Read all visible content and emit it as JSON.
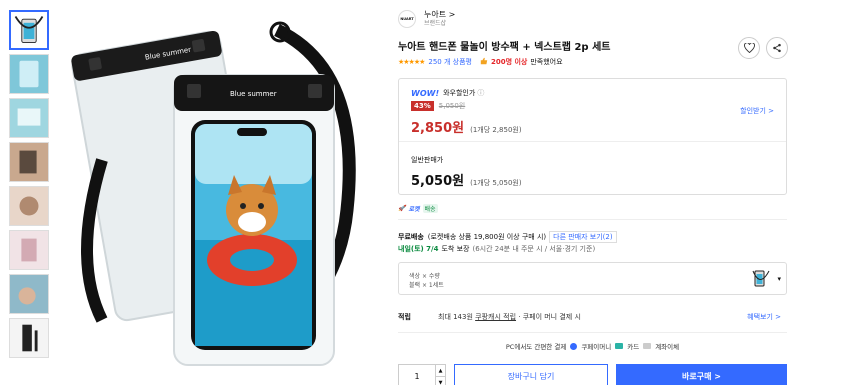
{
  "brand": {
    "logo_text": "NUART",
    "name": "누아트",
    "chevron": ">",
    "subtitle": "브랜드샵"
  },
  "product": {
    "title": "누아트 핸드폰 물놀이 방수팩 + 넥스트랩 2p 세트",
    "pouch_label": "Blue summer"
  },
  "rating": {
    "stars": "★★★★★",
    "review_count": "250 개 상품평",
    "satisfied_count": "200명 이상",
    "satisfied_text": "만족했어요"
  },
  "wow": {
    "logo": "WOW!",
    "label": "와우할인가",
    "info": "ⓘ",
    "discount": "43%",
    "original_price": "5,050원",
    "price": "2,850원",
    "unit_price": "(1개당 2,850원)",
    "coupon": "할인받기 >"
  },
  "normal": {
    "label": "일반판매가",
    "price": "5,050원",
    "unit_price": "(1개당 5,050원)"
  },
  "rocket": {
    "badge": "로켓",
    "tag": "배송"
  },
  "shipping": {
    "free_label": "무료배송",
    "free_text": "(로켓배송 상품 19,800원 이상 구매 시)",
    "other_seller": "다른 판매자 보기(2)",
    "arrive": "내일(토) 7/4",
    "arrive_suffix": "도착 보장",
    "note": "(6시간 24분 내 주문 시 / 서울·경기 기준)"
  },
  "option": {
    "line1": "색상 × 수량",
    "line2": "블랙 × 1세트",
    "caret": "▾"
  },
  "points": {
    "label": "적립",
    "text_prefix": "최대 143원",
    "text_link": "쿠팡캐시 적립",
    "text_suffix": "· 쿠페이 머니 결제 시",
    "benefit": "혜택보기 >"
  },
  "payment": {
    "text": "PC에서도 간편한 결제",
    "methods": [
      "쿠페이머니",
      "카드",
      "계좌이체"
    ]
  },
  "purchase": {
    "quantity": "1",
    "up": "▲",
    "down": "▼",
    "cart": "장바구니 담기",
    "buy": "바로구매 >"
  },
  "colors": {
    "accent": "#346aff",
    "discount": "#c82f2b",
    "green": "#0a8a3f"
  }
}
